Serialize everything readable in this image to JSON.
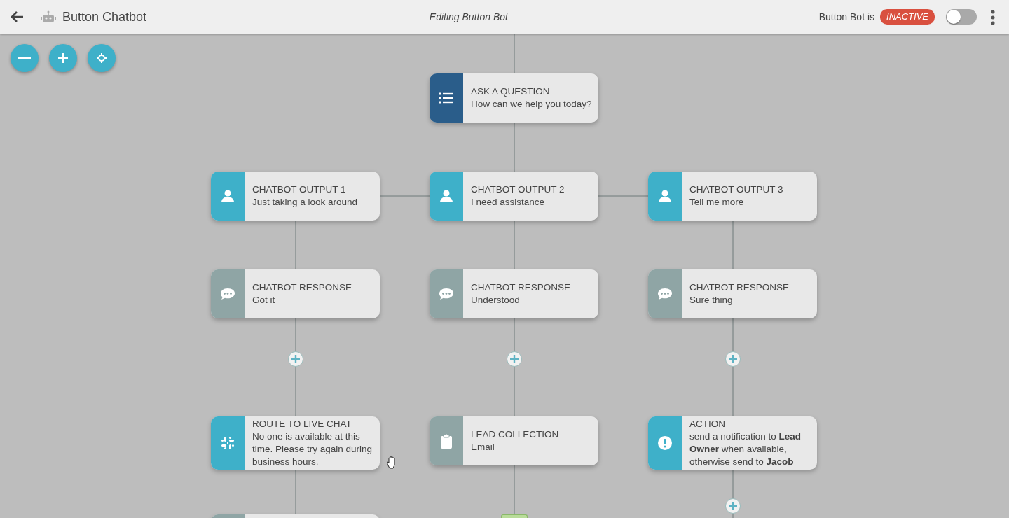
{
  "header": {
    "title": "Button Chatbot",
    "subtitle": "Editing Button Bot",
    "status_label": "Button Bot is",
    "status_badge": "INACTIVE",
    "active": false
  },
  "zoom_controls": [
    {
      "kind": "zoom-out"
    },
    {
      "kind": "zoom-in"
    },
    {
      "kind": "recenter"
    }
  ],
  "flow": {
    "root": {
      "kind": "question",
      "title": "ASK A QUESTION",
      "text": "How can we help you today?"
    },
    "branches": [
      {
        "steps": [
          {
            "kind": "output",
            "title": "CHATBOT OUTPUT 1",
            "text": "Just taking a look around"
          },
          {
            "kind": "response",
            "title": "CHATBOT RESPONSE",
            "text": "Got it"
          },
          {
            "kind": "live-chat",
            "title": "ROUTE TO LIVE CHAT",
            "text": "No one is available at this time. Please try again during business hours."
          }
        ],
        "next": {
          "kind": "node"
        }
      },
      {
        "steps": [
          {
            "kind": "output",
            "title": "CHATBOT OUTPUT 2",
            "text": "I need assistance"
          },
          {
            "kind": "response",
            "title": "CHATBOT RESPONSE",
            "text": "Understood"
          },
          {
            "kind": "lead-collection",
            "title": "LEAD COLLECTION",
            "text": "Email"
          }
        ],
        "next": {
          "kind": "end"
        }
      },
      {
        "steps": [
          {
            "kind": "output",
            "title": "CHATBOT OUTPUT 3",
            "text": "Tell me more"
          },
          {
            "kind": "response",
            "title": "CHATBOT RESPONSE",
            "text": "Sure thing"
          },
          {
            "kind": "action",
            "title": "ACTION",
            "text": "send a notification to **Lead Owner** when available, otherwise send to **Jacob**"
          }
        ],
        "next": {
          "kind": "add"
        }
      }
    ]
  }
}
